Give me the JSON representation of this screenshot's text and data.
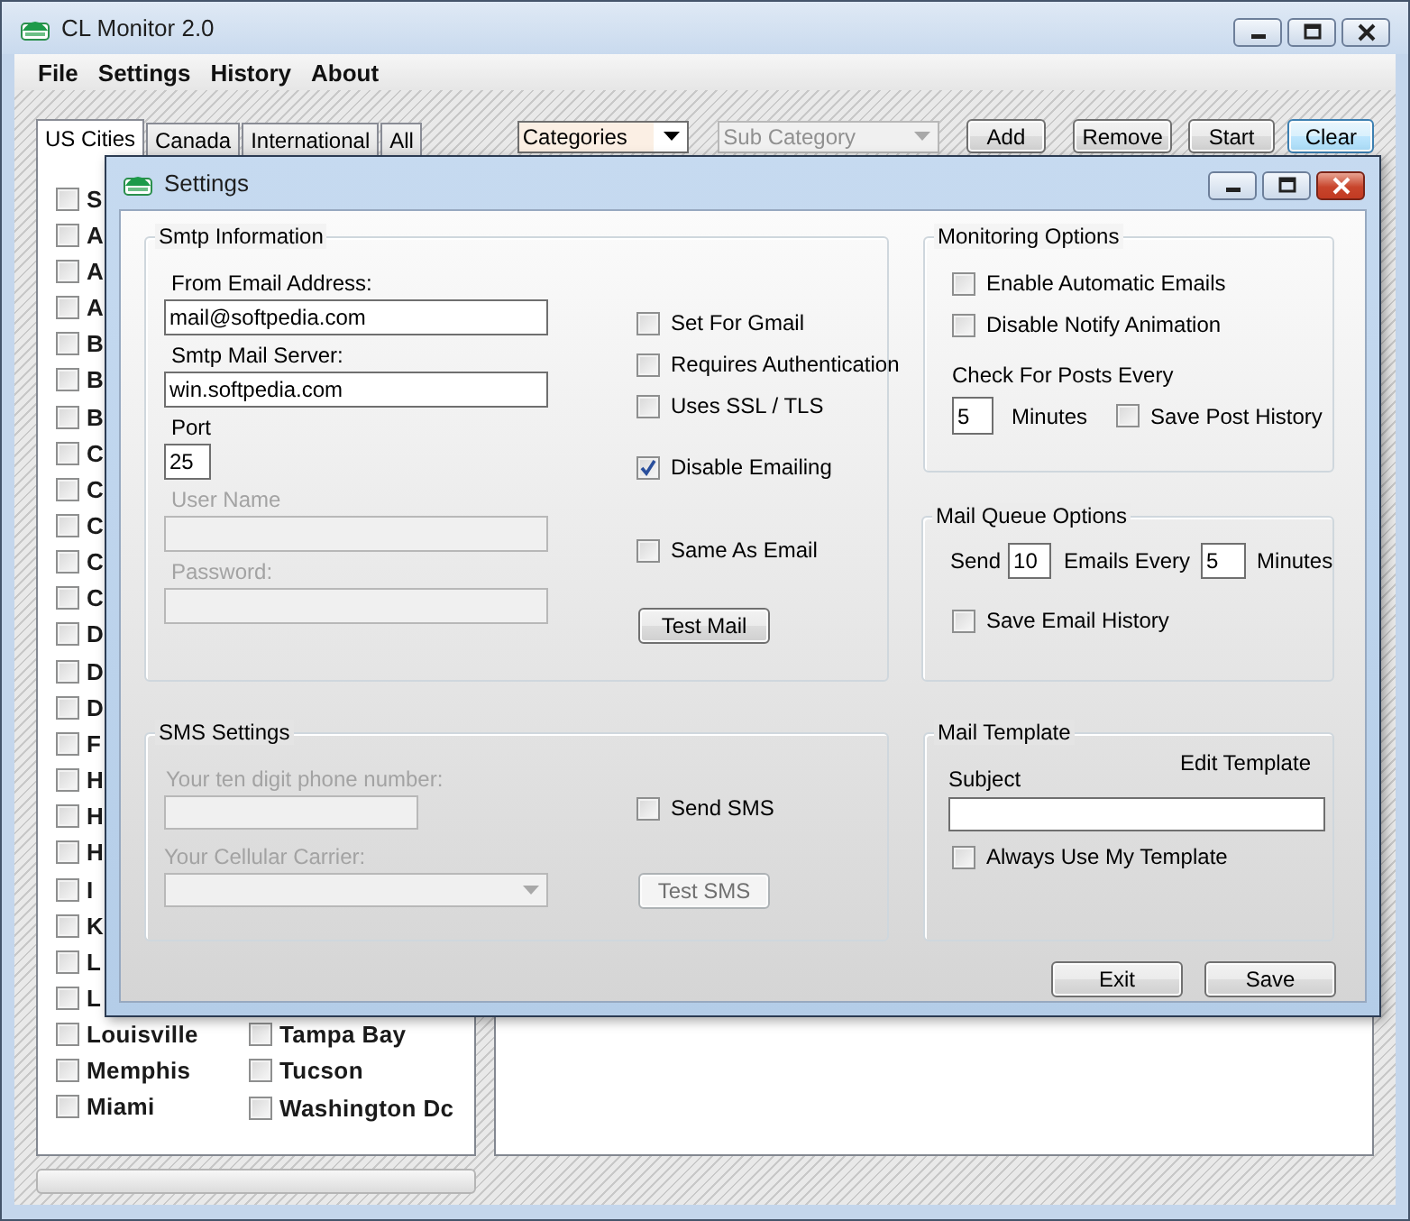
{
  "window": {
    "title": "CL Monitor 2.0"
  },
  "menu": [
    "File",
    "Settings",
    "History",
    "About"
  ],
  "tabs": [
    {
      "label": "US Cities",
      "selected": true
    },
    {
      "label": "Canada",
      "selected": false
    },
    {
      "label": "International",
      "selected": false
    },
    {
      "label": "All",
      "selected": false
    }
  ],
  "category_dropdown": {
    "value": "Categories",
    "disabled": false
  },
  "subcategory_dropdown": {
    "value": "Sub Category",
    "disabled": true
  },
  "toolbar_buttons": [
    {
      "label": "Add",
      "highlighted": false
    },
    {
      "label": "Remove",
      "highlighted": false
    },
    {
      "label": "Start",
      "highlighted": false
    },
    {
      "label": "Clear",
      "highlighted": true
    }
  ],
  "city_list": {
    "columns": [
      [
        {
          "name": "S",
          "checked": false
        },
        {
          "name": "A",
          "checked": false
        },
        {
          "name": "A",
          "checked": false
        },
        {
          "name": "A",
          "checked": false
        },
        {
          "name": "B",
          "checked": false
        },
        {
          "name": "B",
          "checked": false
        },
        {
          "name": "B",
          "checked": false
        },
        {
          "name": "C",
          "checked": false
        },
        {
          "name": "C",
          "checked": false
        },
        {
          "name": "C",
          "checked": false
        },
        {
          "name": "C",
          "checked": false
        },
        {
          "name": "C",
          "checked": false
        },
        {
          "name": "D",
          "checked": false
        },
        {
          "name": "D",
          "checked": false
        },
        {
          "name": "D",
          "checked": false
        },
        {
          "name": "F",
          "checked": false
        },
        {
          "name": "H",
          "checked": false
        },
        {
          "name": "H",
          "checked": false
        },
        {
          "name": "H",
          "checked": false
        },
        {
          "name": "I",
          "checked": false
        },
        {
          "name": "K",
          "checked": false
        },
        {
          "name": "L",
          "checked": false
        },
        {
          "name": "L",
          "checked": false
        },
        {
          "name": "Louisville",
          "checked": false
        },
        {
          "name": "Memphis",
          "checked": false
        },
        {
          "name": "Miami",
          "checked": false
        }
      ],
      [
        {
          "name": "Tampa Bay",
          "checked": false
        },
        {
          "name": "Tucson",
          "checked": false
        },
        {
          "name": "Washington Dc",
          "checked": false
        }
      ]
    ]
  },
  "settings_dialog": {
    "title": "Settings",
    "smtp": {
      "title": "Smtp Information",
      "fields": [
        {
          "label": "From Email Address:",
          "value": "mail@softpedia.com",
          "disabled": false,
          "kind": "text"
        },
        {
          "label": "Smtp Mail Server:",
          "value": "win.softpedia.com",
          "disabled": false,
          "kind": "text"
        },
        {
          "label": "Port",
          "value": "25",
          "disabled": false,
          "kind": "number"
        },
        {
          "label": "User Name",
          "disabled": true,
          "kind": "text"
        },
        {
          "label": "Password:",
          "disabled": true,
          "kind": "text"
        }
      ],
      "options": [
        {
          "label": "Set For Gmail",
          "checked": false
        },
        {
          "label": "Requires Authentication",
          "checked": false
        },
        {
          "label": "Uses SSL / TLS",
          "checked": false
        },
        {
          "label": "Disable Emailing",
          "checked": true
        },
        {
          "label": "Same As Email",
          "checked": false
        }
      ],
      "test_button": {
        "label": "Test Mail",
        "disabled": false
      }
    },
    "sms": {
      "title": "SMS Settings",
      "phone": {
        "label": "Your ten digit phone number:",
        "disabled": true
      },
      "carrier": {
        "label": "Your Cellular Carrier:",
        "disabled": true
      },
      "send_sms": {
        "label": "Send SMS",
        "checked": false
      },
      "test_button": {
        "label": "Test SMS",
        "disabled": true
      }
    },
    "monitoring": {
      "title": "Monitoring Options",
      "options": [
        {
          "label": "Enable Automatic Emails",
          "checked": false
        },
        {
          "label": "Disable Notify Animation",
          "checked": false
        }
      ],
      "interval_label": "Check For Posts Every",
      "interval": "5",
      "interval_unit": "Minutes",
      "save_history": {
        "label": "Save Post History",
        "checked": false
      }
    },
    "mail_queue": {
      "title": "Mail Queue Options",
      "send_label": "Send",
      "count": "10",
      "every_label": "Emails Every",
      "minutes": "5",
      "unit": "Minutes",
      "save_history": {
        "label": "Save Email History",
        "checked": false
      }
    },
    "mail_template": {
      "title": "Mail Template",
      "edit_label": "Edit Template",
      "subject_label": "Subject",
      "always_use": {
        "label": "Always Use My Template",
        "checked": false
      }
    },
    "buttons": [
      {
        "label": "Exit"
      },
      {
        "label": "Save"
      }
    ]
  }
}
